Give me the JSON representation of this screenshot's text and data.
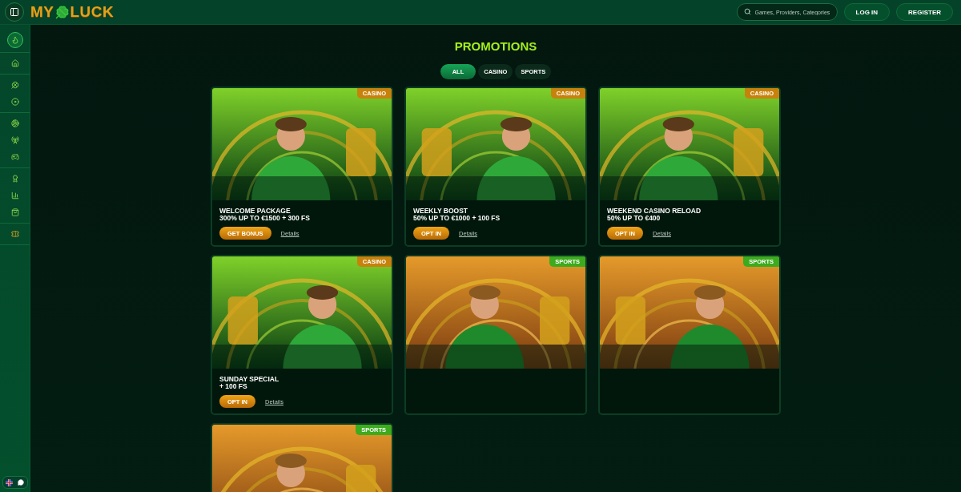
{
  "header": {
    "logo_left": "MY",
    "logo_right": "LUCK",
    "search": {
      "placeholder": "Games, Providers, Categories"
    },
    "buttons": [
      "LOG IN",
      "REGISTER"
    ]
  },
  "sidebar": {
    "groups": [
      [
        {
          "selected": true
        }
      ],
      [
        {
          "selected": false
        }
      ],
      [
        {
          "selected": false
        },
        {
          "selected": false
        }
      ],
      [
        {
          "selected": false
        },
        {
          "selected": false
        },
        {
          "selected": false
        }
      ],
      [
        {
          "selected": false
        },
        {
          "selected": false
        },
        {
          "selected": false
        }
      ],
      [
        {
          "selected": false
        }
      ]
    ]
  },
  "title": "PROMOTIONS",
  "tabs": [
    {
      "label": "ALL",
      "selected": true
    },
    {
      "label": "CASINO",
      "selected": false
    },
    {
      "label": "SPORTS",
      "selected": false
    }
  ],
  "cards": [
    {
      "tag": "CASINO",
      "kind": "casino",
      "title": "WELCOME PACKAGE",
      "subtitle": "300% UP TO €1500 + 300 FS",
      "button": "GET BONUS",
      "link": "Details"
    },
    {
      "tag": "CASINO",
      "kind": "casino",
      "title": "WEEKLY BOOST",
      "subtitle": "50% UP TO €1000 + 100 FS",
      "button": "OPT IN",
      "link": "Details"
    },
    {
      "tag": "CASINO",
      "kind": "casino",
      "title": "WEEKEND CASINO RELOAD",
      "subtitle": "50% UP TO €400",
      "button": "OPT IN",
      "link": "Details"
    },
    {
      "tag": "CASINO",
      "kind": "casino",
      "title": "SUNDAY SPECIAL",
      "subtitle": "+ 100 FS",
      "button": "OPT IN",
      "link": "Details"
    },
    {
      "tag": "SPORTS",
      "kind": "sports"
    },
    {
      "tag": "SPORTS",
      "kind": "sports"
    },
    {
      "tag": "SPORTS",
      "kind": "sports"
    }
  ]
}
